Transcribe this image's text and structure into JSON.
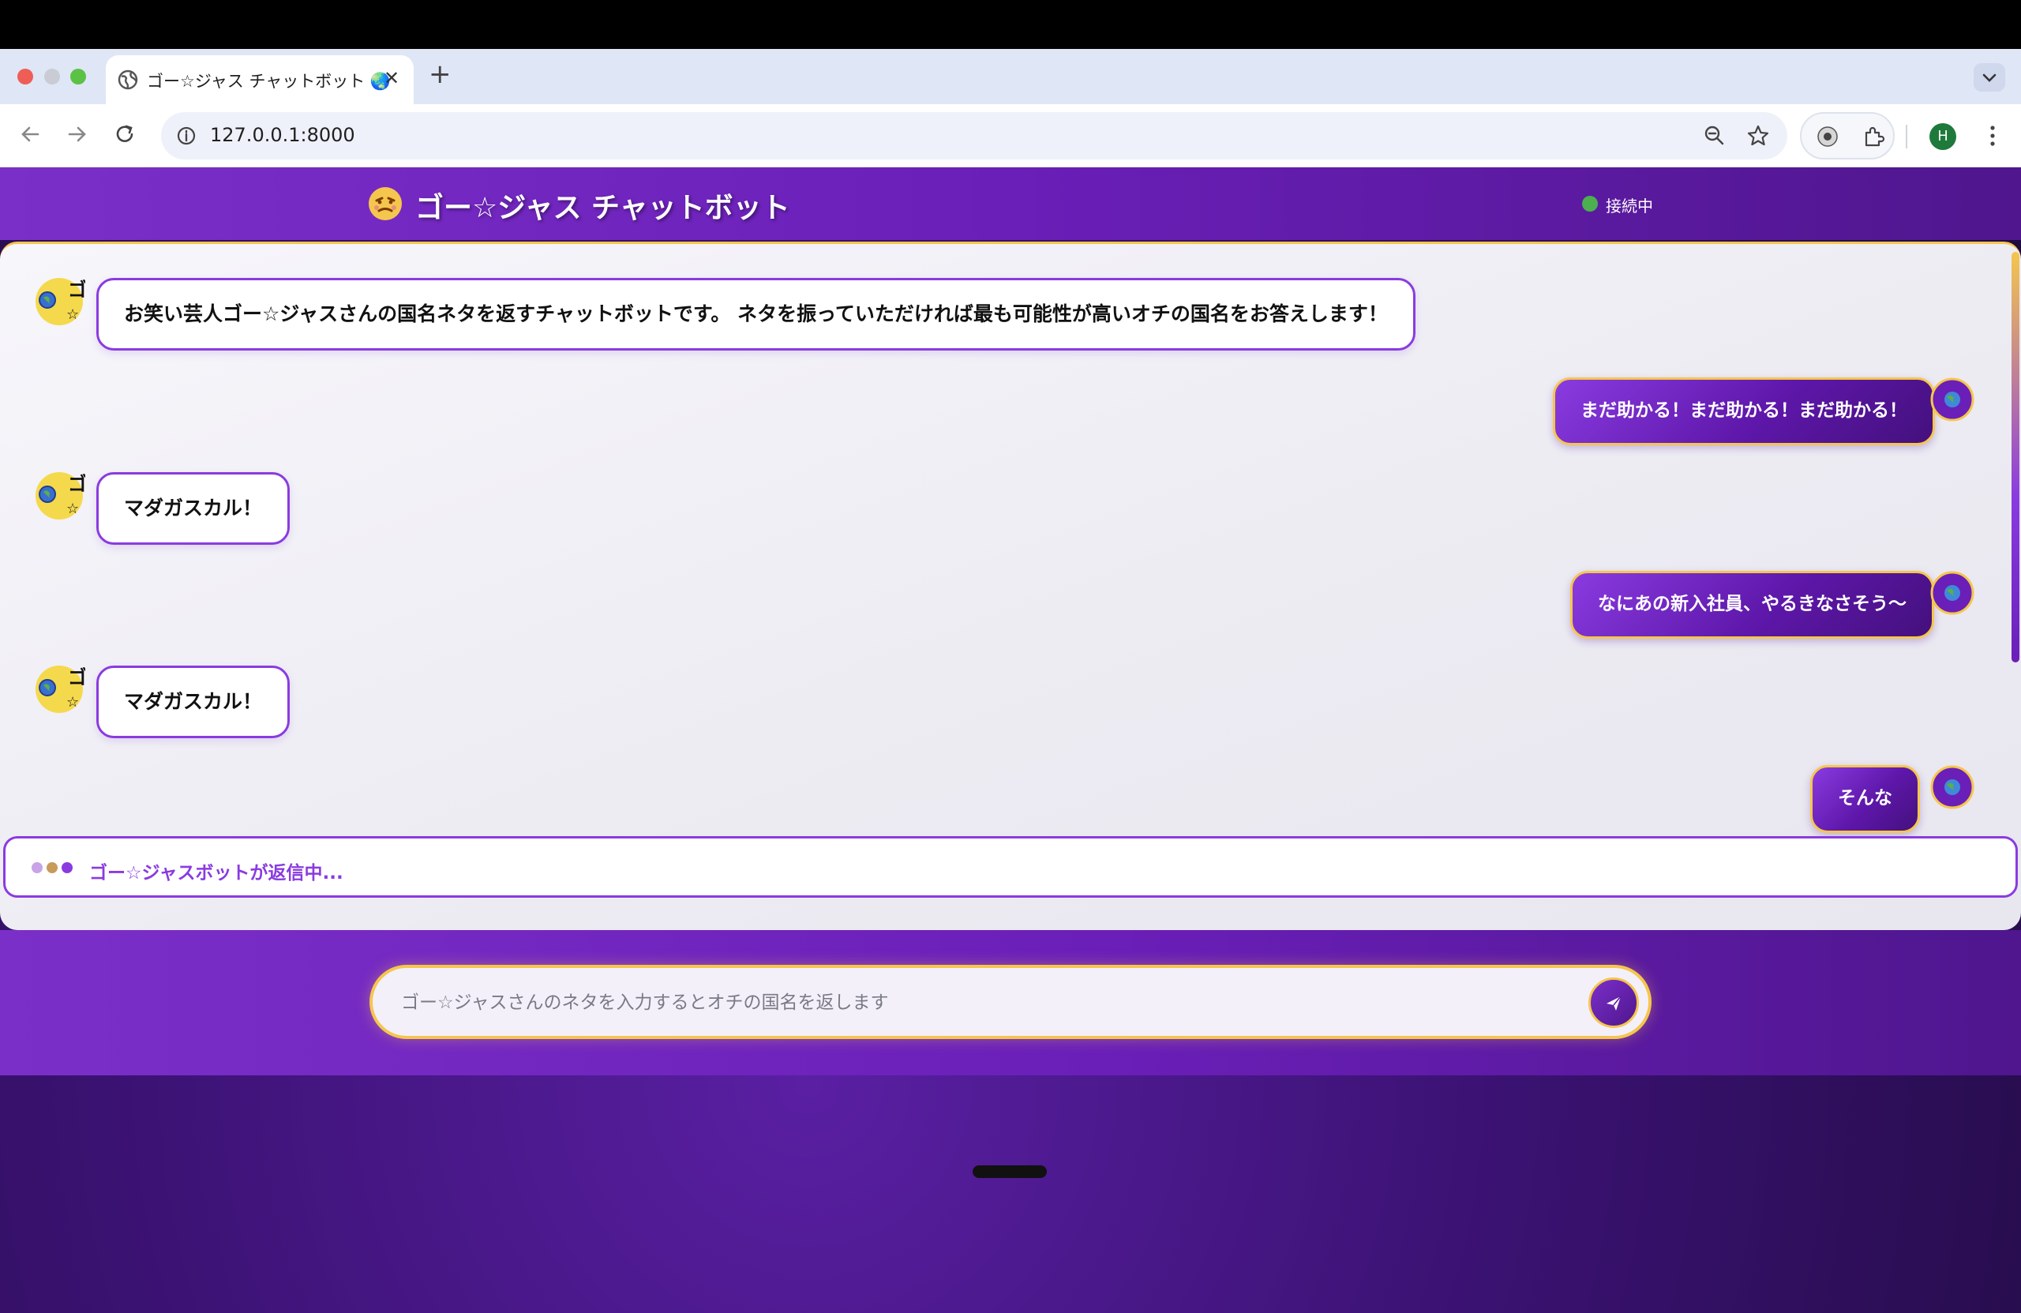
{
  "browser": {
    "tab_title": "ゴー☆ジャス チャットボット 🌏",
    "url": "127.0.0.1:8000",
    "profile_initial": "H"
  },
  "app": {
    "title": "ゴー☆ジャス チャットボット",
    "status": "接続中",
    "bot_avatar_text": "ゴ",
    "messages": [
      {
        "role": "bot",
        "text": "お笑い芸人ゴー☆ジャスさんの国名ネタを返すチャットボットです。 ネタを振っていただければ最も可能性が高いオチの国名をお答えします！"
      },
      {
        "role": "user",
        "text": "まだ助かる！まだ助かる！まだ助かる！"
      },
      {
        "role": "bot",
        "text": "マダガスカル！"
      },
      {
        "role": "user",
        "text": "なにあの新入社員、やるきなさそう～"
      },
      {
        "role": "bot",
        "text": "マダガスカル！"
      },
      {
        "role": "user",
        "text": "そんな"
      }
    ],
    "typing_text": "ゴー☆ジャスボットが返信中...",
    "input_placeholder": "ゴー☆ジャスさんのネタを入力するとオチの国名を返します"
  },
  "colors": {
    "brand_purple": "#6a1fb8",
    "accent_gold": "#f5c64d",
    "status_green": "#4caf50"
  },
  "icons": [
    "globe-icon",
    "close-icon",
    "plus-icon",
    "back-arrow-icon",
    "forward-arrow-icon",
    "reload-icon",
    "info-icon",
    "zoom-icon",
    "star-icon",
    "puzzle-icon",
    "kebab-menu-icon",
    "face-icon",
    "send-icon"
  ]
}
